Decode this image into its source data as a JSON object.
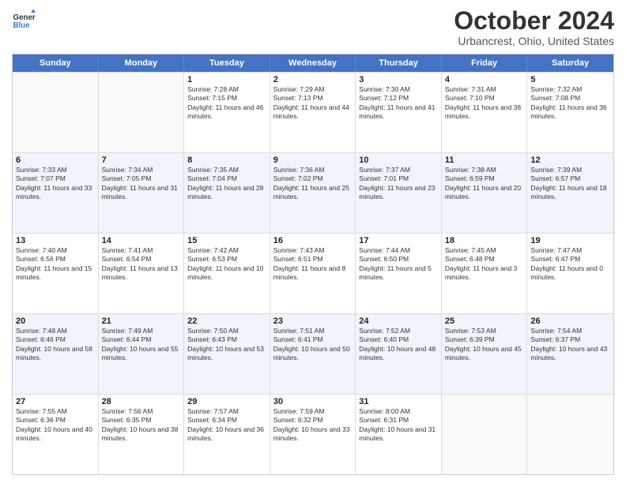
{
  "header": {
    "logo_general": "General",
    "logo_blue": "Blue",
    "title": "October 2024",
    "location": "Urbancrest, Ohio, United States"
  },
  "days_of_week": [
    "Sunday",
    "Monday",
    "Tuesday",
    "Wednesday",
    "Thursday",
    "Friday",
    "Saturday"
  ],
  "weeks": [
    {
      "alt": false,
      "cells": [
        {
          "day": "",
          "sunrise": "",
          "sunset": "",
          "daylight": ""
        },
        {
          "day": "",
          "sunrise": "",
          "sunset": "",
          "daylight": ""
        },
        {
          "day": "1",
          "sunrise": "Sunrise: 7:28 AM",
          "sunset": "Sunset: 7:15 PM",
          "daylight": "Daylight: 11 hours and 46 minutes."
        },
        {
          "day": "2",
          "sunrise": "Sunrise: 7:29 AM",
          "sunset": "Sunset: 7:13 PM",
          "daylight": "Daylight: 11 hours and 44 minutes."
        },
        {
          "day": "3",
          "sunrise": "Sunrise: 7:30 AM",
          "sunset": "Sunset: 7:12 PM",
          "daylight": "Daylight: 11 hours and 41 minutes."
        },
        {
          "day": "4",
          "sunrise": "Sunrise: 7:31 AM",
          "sunset": "Sunset: 7:10 PM",
          "daylight": "Daylight: 11 hours and 38 minutes."
        },
        {
          "day": "5",
          "sunrise": "Sunrise: 7:32 AM",
          "sunset": "Sunset: 7:08 PM",
          "daylight": "Daylight: 11 hours and 36 minutes."
        }
      ]
    },
    {
      "alt": true,
      "cells": [
        {
          "day": "6",
          "sunrise": "Sunrise: 7:33 AM",
          "sunset": "Sunset: 7:07 PM",
          "daylight": "Daylight: 11 hours and 33 minutes."
        },
        {
          "day": "7",
          "sunrise": "Sunrise: 7:34 AM",
          "sunset": "Sunset: 7:05 PM",
          "daylight": "Daylight: 11 hours and 31 minutes."
        },
        {
          "day": "8",
          "sunrise": "Sunrise: 7:35 AM",
          "sunset": "Sunset: 7:04 PM",
          "daylight": "Daylight: 11 hours and 28 minutes."
        },
        {
          "day": "9",
          "sunrise": "Sunrise: 7:36 AM",
          "sunset": "Sunset: 7:02 PM",
          "daylight": "Daylight: 11 hours and 25 minutes."
        },
        {
          "day": "10",
          "sunrise": "Sunrise: 7:37 AM",
          "sunset": "Sunset: 7:01 PM",
          "daylight": "Daylight: 11 hours and 23 minutes."
        },
        {
          "day": "11",
          "sunrise": "Sunrise: 7:38 AM",
          "sunset": "Sunset: 6:59 PM",
          "daylight": "Daylight: 11 hours and 20 minutes."
        },
        {
          "day": "12",
          "sunrise": "Sunrise: 7:39 AM",
          "sunset": "Sunset: 6:57 PM",
          "daylight": "Daylight: 11 hours and 18 minutes."
        }
      ]
    },
    {
      "alt": false,
      "cells": [
        {
          "day": "13",
          "sunrise": "Sunrise: 7:40 AM",
          "sunset": "Sunset: 6:56 PM",
          "daylight": "Daylight: 11 hours and 15 minutes."
        },
        {
          "day": "14",
          "sunrise": "Sunrise: 7:41 AM",
          "sunset": "Sunset: 6:54 PM",
          "daylight": "Daylight: 11 hours and 13 minutes."
        },
        {
          "day": "15",
          "sunrise": "Sunrise: 7:42 AM",
          "sunset": "Sunset: 6:53 PM",
          "daylight": "Daylight: 11 hours and 10 minutes."
        },
        {
          "day": "16",
          "sunrise": "Sunrise: 7:43 AM",
          "sunset": "Sunset: 6:51 PM",
          "daylight": "Daylight: 11 hours and 8 minutes."
        },
        {
          "day": "17",
          "sunrise": "Sunrise: 7:44 AM",
          "sunset": "Sunset: 6:50 PM",
          "daylight": "Daylight: 11 hours and 5 minutes."
        },
        {
          "day": "18",
          "sunrise": "Sunrise: 7:45 AM",
          "sunset": "Sunset: 6:48 PM",
          "daylight": "Daylight: 11 hours and 3 minutes."
        },
        {
          "day": "19",
          "sunrise": "Sunrise: 7:47 AM",
          "sunset": "Sunset: 6:47 PM",
          "daylight": "Daylight: 11 hours and 0 minutes."
        }
      ]
    },
    {
      "alt": true,
      "cells": [
        {
          "day": "20",
          "sunrise": "Sunrise: 7:48 AM",
          "sunset": "Sunset: 6:46 PM",
          "daylight": "Daylight: 10 hours and 58 minutes."
        },
        {
          "day": "21",
          "sunrise": "Sunrise: 7:49 AM",
          "sunset": "Sunset: 6:44 PM",
          "daylight": "Daylight: 10 hours and 55 minutes."
        },
        {
          "day": "22",
          "sunrise": "Sunrise: 7:50 AM",
          "sunset": "Sunset: 6:43 PM",
          "daylight": "Daylight: 10 hours and 53 minutes."
        },
        {
          "day": "23",
          "sunrise": "Sunrise: 7:51 AM",
          "sunset": "Sunset: 6:41 PM",
          "daylight": "Daylight: 10 hours and 50 minutes."
        },
        {
          "day": "24",
          "sunrise": "Sunrise: 7:52 AM",
          "sunset": "Sunset: 6:40 PM",
          "daylight": "Daylight: 10 hours and 48 minutes."
        },
        {
          "day": "25",
          "sunrise": "Sunrise: 7:53 AM",
          "sunset": "Sunset: 6:39 PM",
          "daylight": "Daylight: 10 hours and 45 minutes."
        },
        {
          "day": "26",
          "sunrise": "Sunrise: 7:54 AM",
          "sunset": "Sunset: 6:37 PM",
          "daylight": "Daylight: 10 hours and 43 minutes."
        }
      ]
    },
    {
      "alt": false,
      "cells": [
        {
          "day": "27",
          "sunrise": "Sunrise: 7:55 AM",
          "sunset": "Sunset: 6:36 PM",
          "daylight": "Daylight: 10 hours and 40 minutes."
        },
        {
          "day": "28",
          "sunrise": "Sunrise: 7:56 AM",
          "sunset": "Sunset: 6:35 PM",
          "daylight": "Daylight: 10 hours and 38 minutes."
        },
        {
          "day": "29",
          "sunrise": "Sunrise: 7:57 AM",
          "sunset": "Sunset: 6:34 PM",
          "daylight": "Daylight: 10 hours and 36 minutes."
        },
        {
          "day": "30",
          "sunrise": "Sunrise: 7:59 AM",
          "sunset": "Sunset: 6:32 PM",
          "daylight": "Daylight: 10 hours and 33 minutes."
        },
        {
          "day": "31",
          "sunrise": "Sunrise: 8:00 AM",
          "sunset": "Sunset: 6:31 PM",
          "daylight": "Daylight: 10 hours and 31 minutes."
        },
        {
          "day": "",
          "sunrise": "",
          "sunset": "",
          "daylight": ""
        },
        {
          "day": "",
          "sunrise": "",
          "sunset": "",
          "daylight": ""
        }
      ]
    }
  ]
}
